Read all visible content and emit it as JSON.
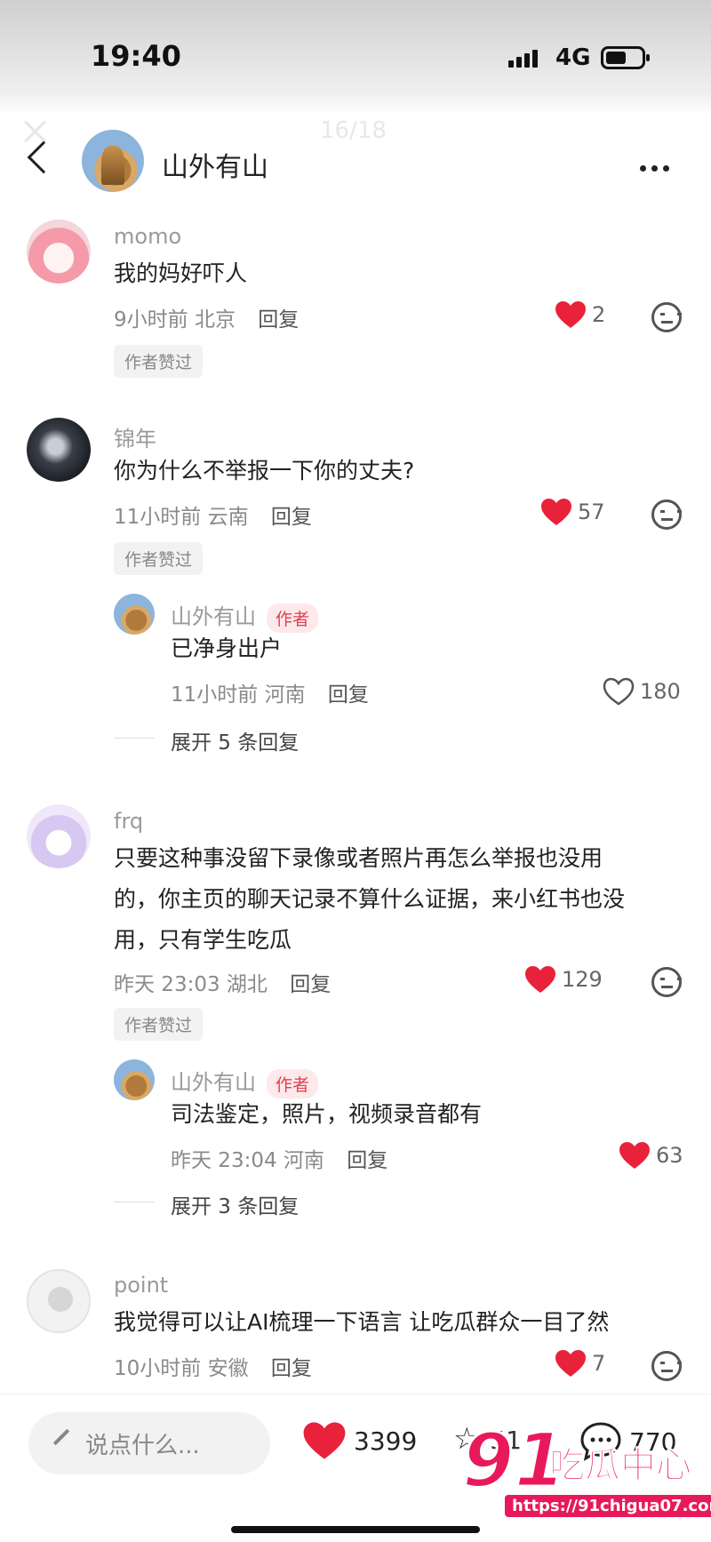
{
  "status": {
    "time": "19:40",
    "network": "4G"
  },
  "viewer": {
    "counter": "16/18"
  },
  "header": {
    "title": "山外有山"
  },
  "comments": [
    {
      "username": "momo",
      "text": "我的妈好吓人",
      "time": "9小时前",
      "location": "北京",
      "reply": "回复",
      "likes": "2",
      "liked": true,
      "badge": "作者赞过"
    },
    {
      "username": "锦年",
      "text": "你为什么不举报一下你的丈夫?",
      "time": "11小时前",
      "location": "云南",
      "reply": "回复",
      "likes": "57",
      "liked": true,
      "badge": "作者赞过",
      "sub": {
        "username": "山外有山",
        "tag": "作者",
        "text": "已净身出户",
        "time": "11小时前",
        "location": "河南",
        "reply": "回复",
        "likes": "180",
        "liked": false,
        "expand": "展开 5 条回复"
      }
    },
    {
      "username": "frq",
      "text_lines": [
        "只要这种事没留下录像或者照片再怎么举报也没用",
        "的，你主页的聊天记录不算什么证据，来小红书也没",
        "用，只有学生吃瓜"
      ],
      "time": "昨天 23:03",
      "location": "湖北",
      "reply": "回复",
      "likes": "129",
      "liked": true,
      "badge": "作者赞过",
      "sub": {
        "username": "山外有山",
        "tag": "作者",
        "text": "司法鉴定，照片，视频录音都有",
        "time": "昨天 23:04",
        "location": "河南",
        "reply": "回复",
        "likes": "63",
        "liked": true,
        "expand": "展开 3 条回复"
      }
    },
    {
      "username": "point",
      "text": "我觉得可以让AI梳理一下语言  让吃瓜群众一目了然",
      "time": "10小时前",
      "location": "安徽",
      "reply": "回复",
      "likes": "7",
      "liked": true
    }
  ],
  "bottom_bar": {
    "placeholder": "说点什么...",
    "likes": "3399",
    "stars": "51",
    "comments": "770"
  },
  "watermark": {
    "logo": "91",
    "name": "吃瓜中心",
    "url": "https://91chigua07.com"
  },
  "colors": {
    "heart": "#e8223a",
    "author_tag": "#e0404f",
    "watermark": "#e8195a"
  }
}
